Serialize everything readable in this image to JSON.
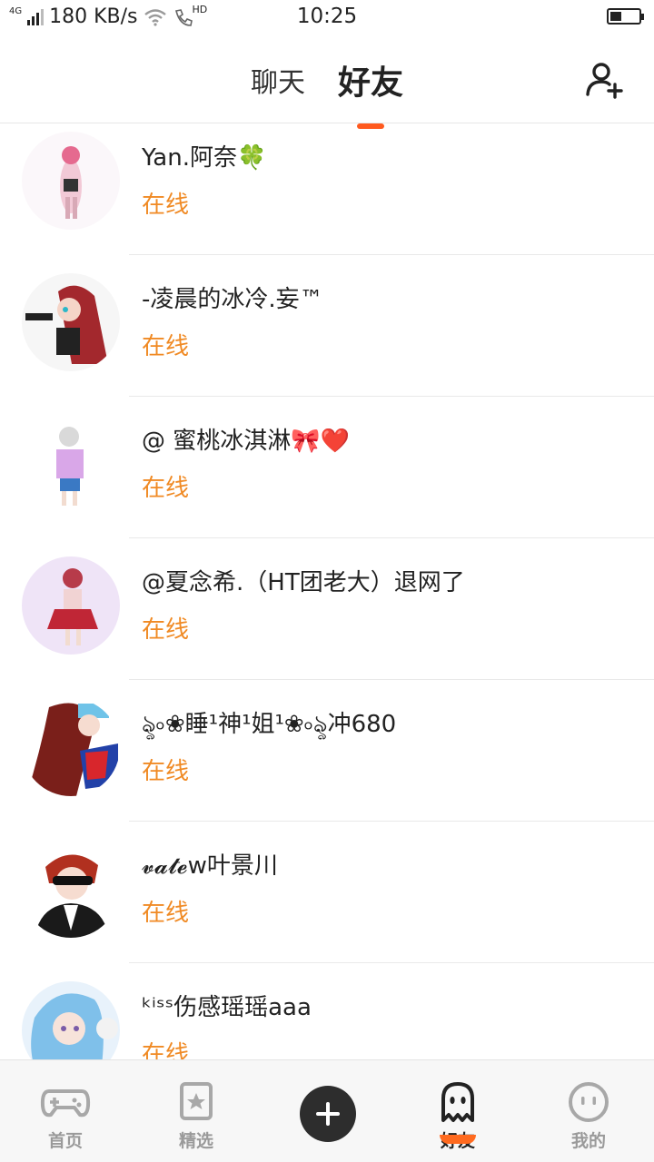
{
  "status_bar": {
    "network": "4G",
    "speed": "180 KB/s",
    "hd": "HD",
    "time": "10:25",
    "battery_level": 0.35
  },
  "header": {
    "tabs": [
      {
        "label": "聊天",
        "active": false
      },
      {
        "label": "好友",
        "active": true
      }
    ],
    "add_friend_icon": "add-user-icon"
  },
  "friends": [
    {
      "name": "Yan.阿奈🍀",
      "status": "在线"
    },
    {
      "name": "-凌晨的冰冷.妄™",
      "status": "在线"
    },
    {
      "name": "@ 蜜桃冰淇淋🎀❤️",
      "status": "在线"
    },
    {
      "name": "@夏念希.（HT团老大）退网了",
      "status": "在线"
    },
    {
      "name": "ৡ৹❀睡¹神¹姐¹❀৹ৡ冲680",
      "status": "在线"
    },
    {
      "name": "𝓿𝓪𝓽𝓮w叶景川",
      "status": "在线"
    },
    {
      "name": "ᵏⁱˢˢ伤感瑶瑶aaa",
      "status": "在线"
    }
  ],
  "bottom_nav": {
    "items": [
      {
        "label": "首页",
        "icon": "gamepad-icon"
      },
      {
        "label": "精选",
        "icon": "star-card-icon"
      },
      {
        "label": "",
        "icon": "plus-icon"
      },
      {
        "label": "好友",
        "icon": "ghost-icon"
      },
      {
        "label": "我的",
        "icon": "face-icon"
      }
    ],
    "active": "好友"
  },
  "colors": {
    "accent": "#ff5a1f",
    "online": "#f08a24",
    "nav_inactive": "#9a9a9a"
  }
}
